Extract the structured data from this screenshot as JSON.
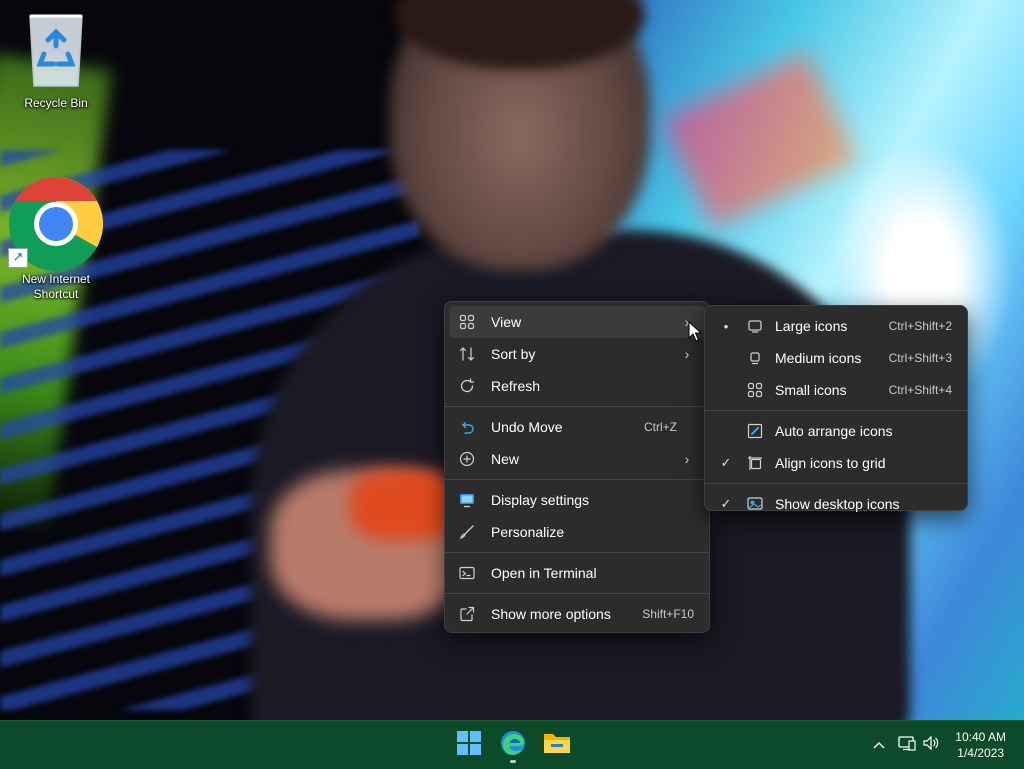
{
  "desktop": {
    "icons": [
      {
        "label": "Recycle Bin",
        "icon": "recycle-bin-icon"
      },
      {
        "label": "New Internet\nShortcut",
        "icon": "chrome-icon"
      }
    ]
  },
  "context_menu": {
    "items": [
      {
        "label": "View",
        "icon": "grid-icon",
        "submenu": true,
        "highlighted": true
      },
      {
        "label": "Sort by",
        "icon": "sort-icon",
        "submenu": true
      },
      {
        "label": "Refresh",
        "icon": "refresh-icon"
      },
      {
        "label": "Undo Move",
        "icon": "undo-icon",
        "shortcut": "Ctrl+Z"
      },
      {
        "label": "New",
        "icon": "new-icon",
        "submenu": true
      },
      {
        "label": "Display settings",
        "icon": "display-icon"
      },
      {
        "label": "Personalize",
        "icon": "brush-icon"
      },
      {
        "label": "Open in Terminal",
        "icon": "terminal-icon"
      },
      {
        "label": "Show more options",
        "icon": "more-options-icon",
        "shortcut": "Shift+F10"
      }
    ]
  },
  "view_submenu": {
    "items": [
      {
        "label": "Large icons",
        "shortcut": "Ctrl+Shift+2",
        "selected": true,
        "mark": "•"
      },
      {
        "label": "Medium icons",
        "shortcut": "Ctrl+Shift+3"
      },
      {
        "label": "Small icons",
        "shortcut": "Ctrl+Shift+4"
      },
      {
        "label": "Auto arrange icons"
      },
      {
        "label": "Align icons to grid",
        "checked": true,
        "mark": "✓"
      },
      {
        "label": "Show desktop icons",
        "checked": true,
        "mark": "✓"
      }
    ]
  },
  "taskbar": {
    "pinned": [
      "start-icon",
      "edge-icon",
      "file-explorer-icon"
    ],
    "tray": [
      "chevron-up-icon",
      "network-icon",
      "volume-icon"
    ],
    "time": "10:40 AM",
    "date": "1/4/2023",
    "accent": "#0c4a2a"
  }
}
